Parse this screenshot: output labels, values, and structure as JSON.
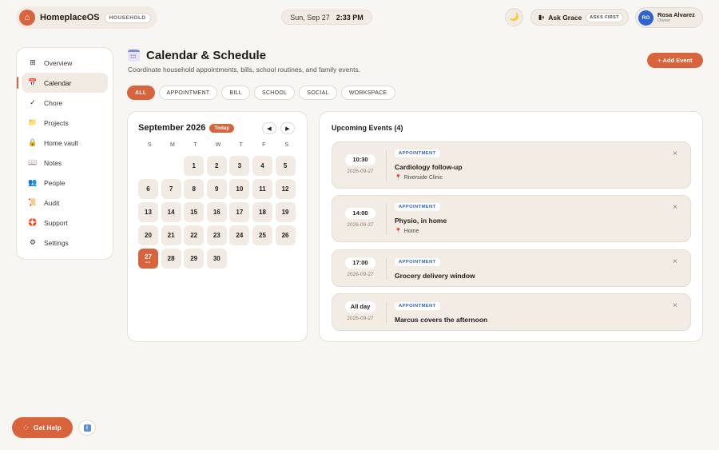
{
  "brand": {
    "logo_icon": "home-icon",
    "name": "HomeplaceOS",
    "badge": "HOUSEHOLD"
  },
  "clock": {
    "date": "Sun, Sep 27",
    "time": "2:33 PM"
  },
  "theme_toggle": {
    "icon": "moon-icon",
    "glyph": "🌙"
  },
  "assistant": {
    "icon_glyph": "▮◖",
    "label": "Ask Grace",
    "badge": "ASKS FIRST"
  },
  "user": {
    "initials": "RO",
    "name": "Rosa Alvarez",
    "role": "Owner"
  },
  "sidebar": {
    "items": [
      {
        "id": "overview",
        "label": "Overview",
        "icon": "⊞"
      },
      {
        "id": "calendar",
        "label": "Calendar",
        "icon": "📅",
        "active": true
      },
      {
        "id": "chore",
        "label": "Chore",
        "icon": "✓"
      },
      {
        "id": "projects",
        "label": "Projects",
        "icon": "📁"
      },
      {
        "id": "home-vault",
        "label": "Home vault",
        "icon": "🔒"
      },
      {
        "id": "notes",
        "label": "Notes",
        "icon": "📖"
      },
      {
        "id": "people",
        "label": "People",
        "icon": "👥"
      },
      {
        "id": "audit",
        "label": "Audit",
        "icon": "📜"
      },
      {
        "id": "support",
        "label": "Support",
        "icon": "🛟"
      },
      {
        "id": "settings",
        "label": "Settings",
        "icon": "⚙"
      }
    ]
  },
  "page": {
    "title": "Calendar & Schedule",
    "subtitle": "Coordinate household appointments, bills, school routines, and family events.",
    "add_event_label": "+ Add Event"
  },
  "filters": [
    "ALL",
    "APPOINTMENT",
    "BILL",
    "SCHOOL",
    "SOCIAL",
    "WORKSPACE"
  ],
  "active_filter": "ALL",
  "calendar": {
    "month_label": "September 2026",
    "today_label": "Today",
    "prev_glyph": "◀",
    "next_glyph": "▶",
    "weekdays": [
      "S",
      "M",
      "T",
      "W",
      "T",
      "F",
      "S"
    ],
    "leading_blanks": 2,
    "days_in_month": 30,
    "today": 27,
    "today_marker": "•••"
  },
  "events_panel": {
    "title": "Upcoming Events (4)",
    "close_glyph": "×",
    "pin_glyph": "📍",
    "events": [
      {
        "time": "10:30",
        "date": "2026-09-27",
        "type": "APPOINTMENT",
        "name": "Cardiology follow-up",
        "location": "Riverside Clinic"
      },
      {
        "time": "14:00",
        "date": "2026-09-27",
        "type": "APPOINTMENT",
        "name": "Physio, in home",
        "location": "Home"
      },
      {
        "time": "17:00",
        "date": "2026-09-27",
        "type": "APPOINTMENT",
        "name": "Grocery delivery window",
        "location": ""
      },
      {
        "time": "All day",
        "date": "2026-09-27",
        "type": "APPOINTMENT",
        "name": "Marcus covers the afternoon",
        "location": ""
      }
    ]
  },
  "help": {
    "label": "Get Help",
    "icon_glyph": "⁘"
  },
  "info_button": {
    "glyph": "i"
  },
  "colors": {
    "accent": "#d9643c",
    "background": "#f8f6f3",
    "tag_blue": "#2e63d6"
  }
}
